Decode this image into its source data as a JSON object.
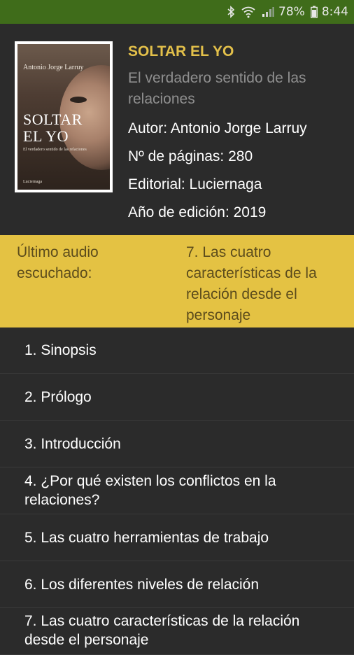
{
  "status_bar": {
    "battery": "78%",
    "time": "8:44"
  },
  "book": {
    "cover": {
      "author": "Antonio Jorge Larruy",
      "title_line1": "SOLTAR",
      "title_line2": "EL YO",
      "subtitle": "El verdadero sentido de las relaciones",
      "publisher": "Luciernaga"
    },
    "title": "SOLTAR EL YO",
    "subtitle": "El verdadero sentido de las relaciones",
    "author": "Autor: Antonio Jorge Larruy",
    "pages": "Nº de páginas: 280",
    "publisher": "Editorial: Luciernaga",
    "year": "Año de edición: 2019"
  },
  "last_audio": {
    "label": "Último audio escuchado:",
    "value": "7. Las cuatro características de la relación desde el personaje"
  },
  "chapters": [
    "1. Sinopsis",
    "2. Prólogo",
    "3. Introducción",
    "4. ¿Por qué existen los conflictos en la relaciones?",
    "5. Las cuatro herramientas de trabajo",
    "6. Los diferentes niveles de relación",
    "7. Las cuatro características de la relación desde el personaje"
  ],
  "colors": {
    "status_bar": "#3f6c1a",
    "background": "#2b2b2b",
    "accent": "#e4c243",
    "title": "#e3c04a"
  }
}
